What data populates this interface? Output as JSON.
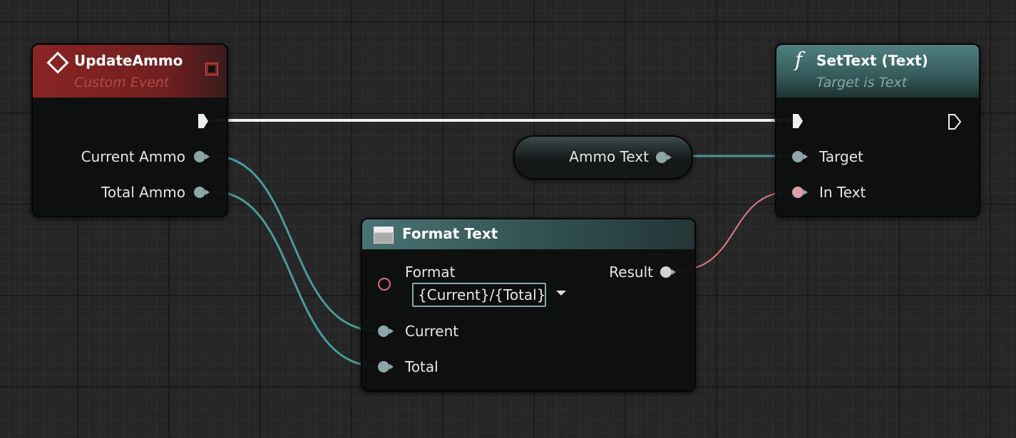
{
  "colors": {
    "event_header": "#8b2424",
    "function_header": "#3f6a6a",
    "exec_wire": "#ffffff",
    "object_wire": "#4a9a9a",
    "text_wire": "#e07b86"
  },
  "update_ammo": {
    "title": "UpdateAmmo",
    "subtitle": "Custom Event",
    "icon": "event-diamond-icon",
    "outputs": [
      "Current Ammo",
      "Total Ammo"
    ]
  },
  "set_text": {
    "title": "SetText (Text)",
    "subtitle": "Target is Text",
    "icon": "function-icon",
    "inputs": [
      "Target",
      "In Text"
    ]
  },
  "ammo_text": {
    "label": "Ammo Text"
  },
  "format_text": {
    "title": "Format Text",
    "icon": "format-text-icon",
    "format_label": "Format",
    "format_value": "{Current}/{Total}",
    "result_label": "Result",
    "inputs": [
      "Current",
      "Total"
    ]
  }
}
